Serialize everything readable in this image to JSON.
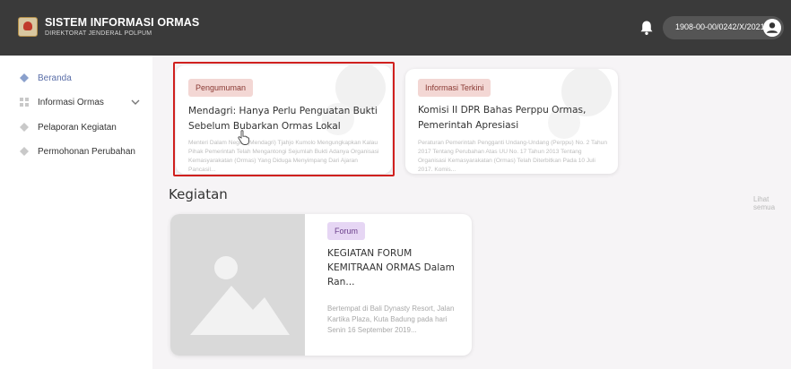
{
  "header": {
    "title": "SISTEM INFORMASI ORMAS",
    "subtitle": "DIREKTORAT JENDERAL POLPUM",
    "user_id": "1908-00-00/0242/X/2021",
    "icons": {
      "logo": "ministry-emblem-icon",
      "notification": "bell-icon",
      "profile": "user-avatar-icon"
    }
  },
  "sidebar": {
    "items": [
      {
        "label": "Beranda",
        "icon": "diamond-icon"
      },
      {
        "label": "Informasi Ormas",
        "icon": "grid-icon"
      },
      {
        "label": "Pelaporan Kegiatan",
        "icon": "diamond-icon"
      },
      {
        "label": "Permohonan Perubahan",
        "icon": "diamond-icon"
      }
    ],
    "active_color": "#5a6ea8"
  },
  "news": [
    {
      "tag": "Pengumuman",
      "title": "Mendagri: Hanya Perlu Penguatan Bukti Sebelum Bubarkan Ormas Lokal",
      "body": "Menteri Dalam Negeri (Mendagri) Tjahjo Kumolo Mengungkapkan Kalau Pihak Pemerintah Telah Mengantongi Sejumlah Bukti Adanya Organisasi Kemasyarakatan (Ormas) Yang Diduga Menyimpang Dari Ajaran Pancasil..."
    },
    {
      "tag": "Informasi Terkini",
      "title": "Komisi II DPR Bahas Perppu Ormas, Pemerintah Apresiasi",
      "body": "Peraturan Pemerintah Pengganti Undang-Undang (Perppu) No. 2 Tahun 2017 Tentang Perubahan Atas UU No. 17 Tahun 2013 Tentang Organisasi Kemasyarakatan (Ormas) Telah Diterbitkan Pada 10 Juli 2017. Komis..."
    }
  ],
  "activities": {
    "section_title": "Kegiatan",
    "see_all": "Lihat semua",
    "items": [
      {
        "tag": "Forum",
        "title": "KEGIATAN FORUM KEMITRAAN ORMAS Dalam Ran...",
        "body": "Bertempat di Bali Dynasty Resort, Jalan Kartika Plaza, Kuta Badung pada hari Senin 16 September 2019..."
      }
    ]
  },
  "colors": {
    "topbar": "#3a3a3a",
    "highlight_border": "#d0201e",
    "tag_pink": "#f3d7d4",
    "tag_purple": "#e6d6f4"
  }
}
